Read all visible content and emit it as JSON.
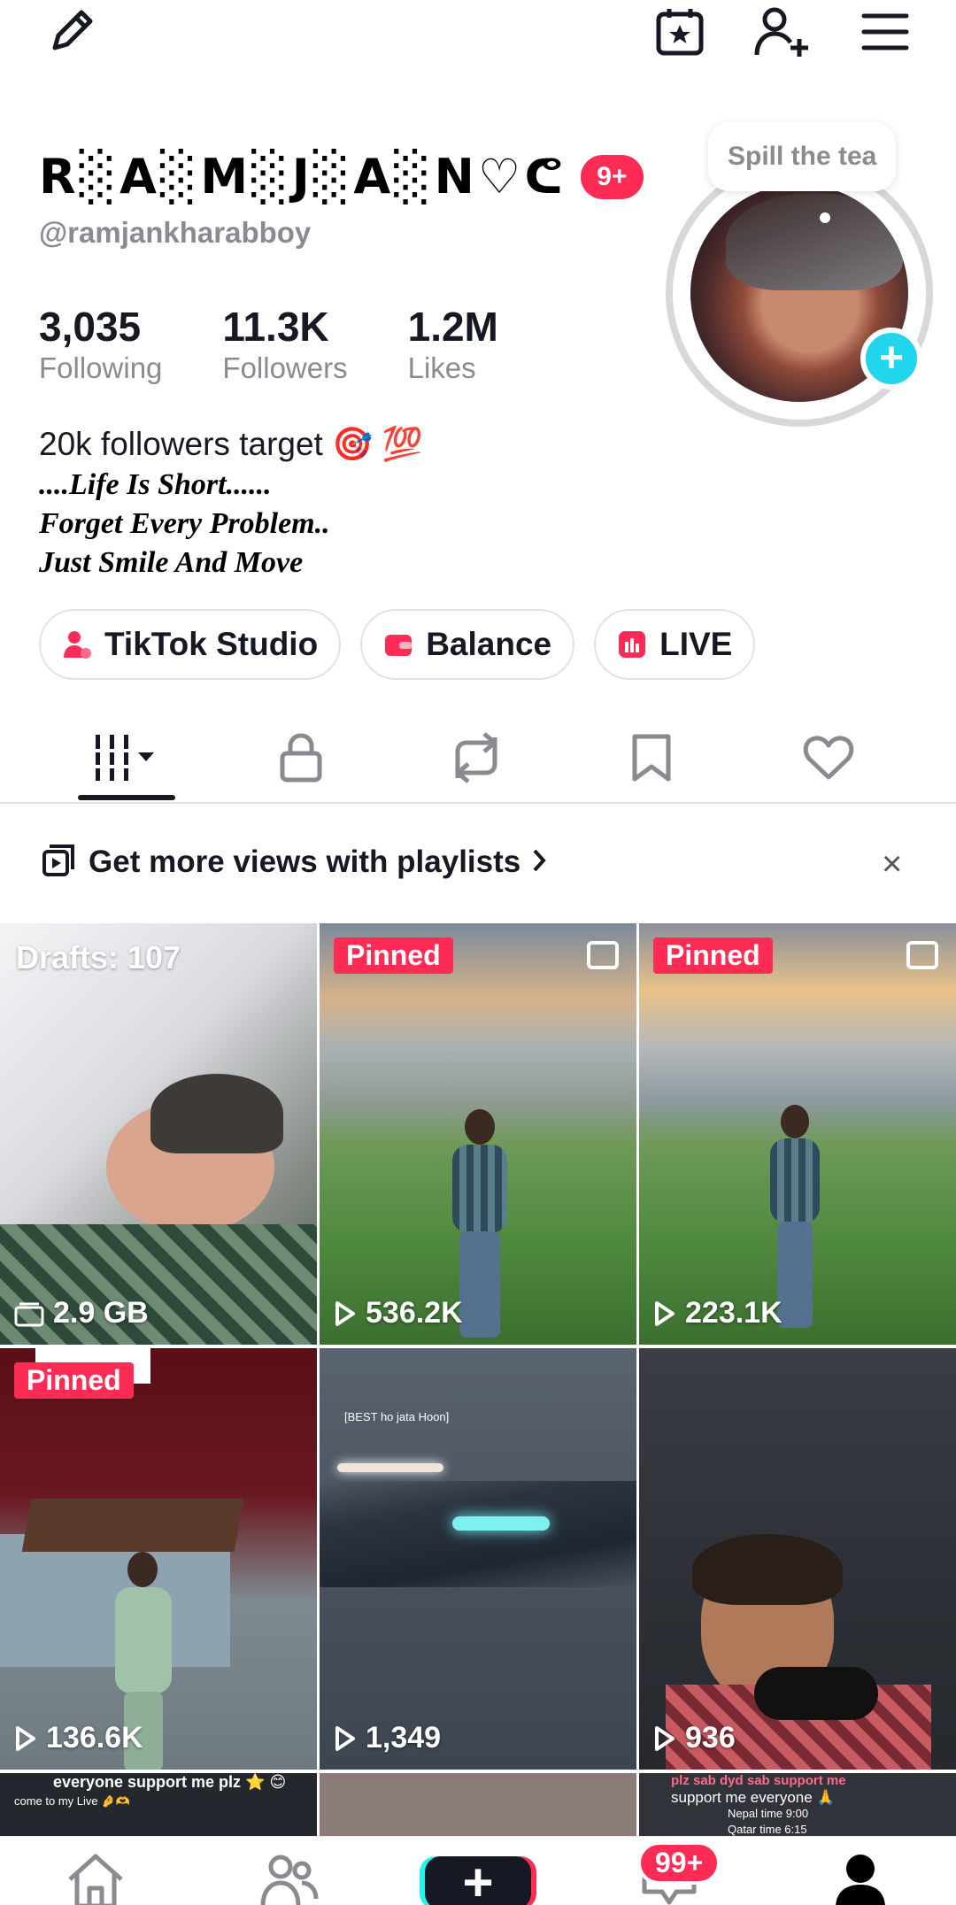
{
  "top_bar": {
    "icons": [
      "edit-icon",
      "calendar-star-icon",
      "add-friend-icon",
      "menu-icon"
    ]
  },
  "profile": {
    "display_name": "R░A░M░J░A░N♡ᕦ",
    "notification_badge": "9+",
    "handle": "@ramjankharabboy",
    "note_bubble": "Spill the tea",
    "stats": [
      {
        "value": "3,035",
        "label": "Following"
      },
      {
        "value": "11.3K",
        "label": "Followers"
      },
      {
        "value": "1.2M",
        "label": "Likes"
      }
    ],
    "bio": {
      "line1": "20k followers target 🎯 💯",
      "line2": "....Life Is Short......",
      "line3": "Forget Every Problem..",
      "line4": "Just Smile And Move"
    },
    "pills": [
      {
        "label": "TikTok Studio",
        "icon": "studio-icon",
        "color": "#fe2c55"
      },
      {
        "label": "Balance",
        "icon": "wallet-icon",
        "color": "#fe2c55"
      },
      {
        "label": "LIVE",
        "icon": "live-icon",
        "color": "#fe2c55"
      }
    ]
  },
  "tabs": {
    "icons": [
      "videos-grid-icon",
      "lock-icon",
      "repost-icon",
      "bookmark-icon",
      "heart-icon"
    ],
    "active": 0
  },
  "playlist_banner": {
    "text": "Get more views with playlists",
    "close": "×"
  },
  "grid": {
    "pinned_label": "Pinned",
    "items": [
      {
        "kind": "drafts",
        "top_label": "Drafts: 107",
        "bottom_label": "2.9 GB"
      },
      {
        "kind": "video",
        "pinned": true,
        "views": "536.2K"
      },
      {
        "kind": "video",
        "pinned": true,
        "views": "223.1K"
      },
      {
        "kind": "video",
        "pinned": true,
        "views": "136.6K"
      },
      {
        "kind": "video",
        "pinned": false,
        "views": "1,349",
        "overlay_text": "[BEST ho jata Hoon]"
      },
      {
        "kind": "video",
        "pinned": false,
        "views": "936"
      }
    ],
    "partial_row": {
      "left_text": "everyone support me plz ⭐ 😊",
      "left_text2": "come to my Live 🤌🫶",
      "right_text": "plz sab dyd sab support me",
      "right_text2": "support me everyone 🙏",
      "right_text3": "Nepal time 9:00",
      "right_text4": "Qatar time 6:15"
    }
  },
  "bottom_nav": {
    "icons": [
      "home-icon",
      "friends-icon",
      "create-icon",
      "inbox-icon",
      "profile-icon"
    ],
    "inbox_badge": "99+",
    "create_symbol": "+"
  },
  "colors": {
    "accent": "#fe2c55",
    "cyan": "#20d5ec",
    "text": "#161823",
    "muted": "#8a8b91"
  }
}
